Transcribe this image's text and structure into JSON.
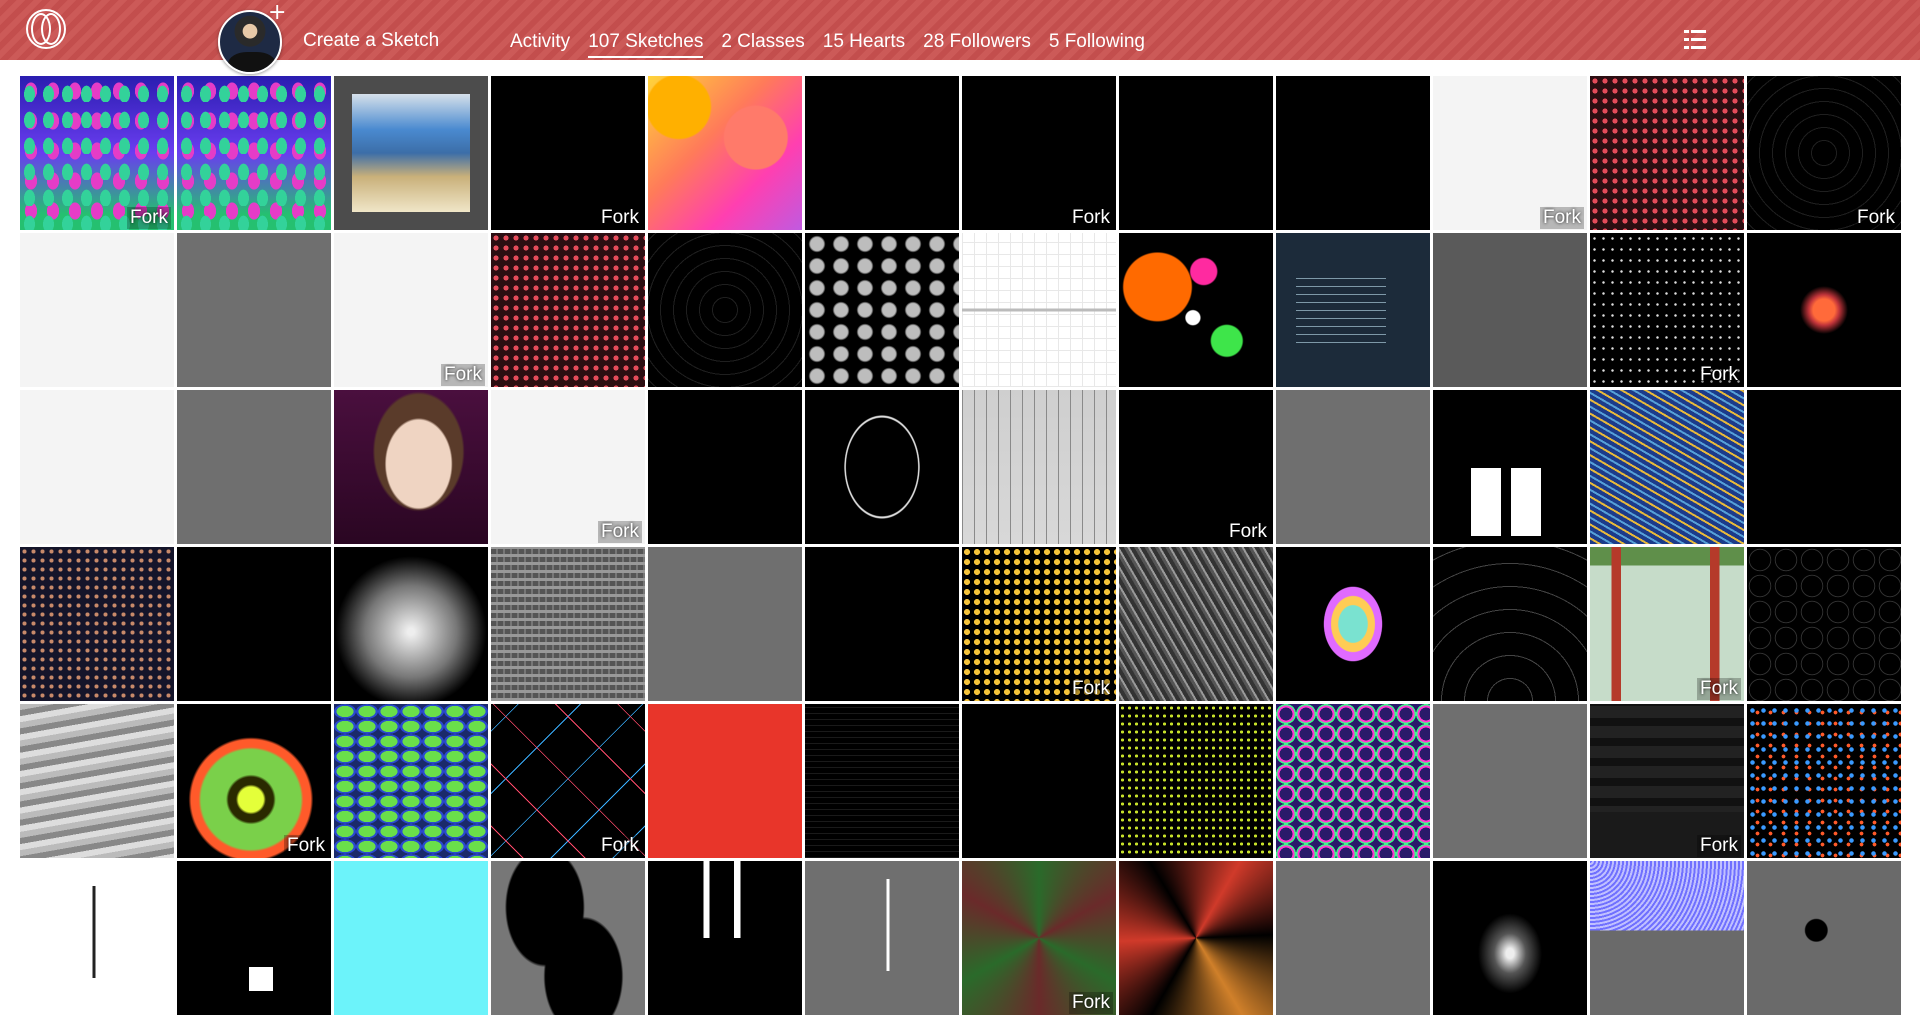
{
  "header": {
    "create_sketch": "Create a Sketch",
    "avatar_plus": "+",
    "nav": [
      {
        "label": "Activity",
        "active": false
      },
      {
        "label": "107 Sketches",
        "active": true
      },
      {
        "label": "2 Classes",
        "active": false
      },
      {
        "label": "15 Hearts",
        "active": false
      },
      {
        "label": "28 Followers",
        "active": false
      },
      {
        "label": "5 Following",
        "active": false
      }
    ],
    "bar_color": "#c9514f"
  },
  "fork_label": "Fork",
  "sketches": [
    {
      "icon": "ovals-pattern",
      "fork": true
    },
    {
      "icon": "ovals-pattern",
      "fork": false
    },
    {
      "icon": "painting",
      "fork": false
    },
    {
      "icon": "dark-dots",
      "fork": true
    },
    {
      "icon": "pastel-cells",
      "fork": false
    },
    {
      "icon": "black-canvas",
      "fork": false
    },
    {
      "icon": "black-canvas",
      "fork": true
    },
    {
      "icon": "dark-dots",
      "fork": false
    },
    {
      "icon": "black-canvas",
      "fork": false
    },
    {
      "icon": "white-canvas",
      "fork": true
    },
    {
      "icon": "flower-circles",
      "fork": false
    },
    {
      "icon": "radar-rings",
      "fork": true
    },
    {
      "icon": "white-canvas",
      "fork": false
    },
    {
      "icon": "gray-canvas",
      "fork": false
    },
    {
      "icon": "white-canvas",
      "fork": true
    },
    {
      "icon": "red-circles",
      "fork": false
    },
    {
      "icon": "radar-rings",
      "fork": false
    },
    {
      "icon": "gray-blobs",
      "fork": false
    },
    {
      "icon": "graph-plot",
      "fork": false
    },
    {
      "icon": "color-bubbles",
      "fork": false
    },
    {
      "icon": "essay-page",
      "fork": false
    },
    {
      "icon": "dark-gray-canvas",
      "fork": false
    },
    {
      "icon": "starfield",
      "fork": true
    },
    {
      "icon": "glow-orb",
      "fork": false
    },
    {
      "icon": "white-canvas",
      "fork": false
    },
    {
      "icon": "gray-canvas",
      "fork": false
    },
    {
      "icon": "portrait",
      "fork": false
    },
    {
      "icon": "white-canvas",
      "fork": true
    },
    {
      "icon": "black-canvas",
      "fork": false
    },
    {
      "icon": "wire-sphere",
      "fork": false
    },
    {
      "icon": "timeline-bars",
      "fork": false
    },
    {
      "icon": "black-canvas",
      "fork": true
    },
    {
      "icon": "gray-canvas",
      "fork": false
    },
    {
      "icon": "kittens",
      "fork": false
    },
    {
      "icon": "swirl-painting",
      "fork": false
    },
    {
      "icon": "black-canvas",
      "fork": false
    },
    {
      "icon": "halftone",
      "fork": false
    },
    {
      "icon": "black-canvas",
      "fork": false
    },
    {
      "icon": "line-burst",
      "fork": false
    },
    {
      "icon": "gray-text",
      "fork": false
    },
    {
      "icon": "gray-canvas",
      "fork": false
    },
    {
      "icon": "black-canvas",
      "fork": false
    },
    {
      "icon": "particles",
      "fork": true
    },
    {
      "icon": "noise-waves",
      "fork": false
    },
    {
      "icon": "color-blob",
      "fork": false
    },
    {
      "icon": "line-arcs",
      "fork": false
    },
    {
      "icon": "golden-gate",
      "fork": true
    },
    {
      "icon": "ring-grid",
      "fork": false
    },
    {
      "icon": "gray-terrain",
      "fork": false
    },
    {
      "icon": "green-spiral",
      "fork": true
    },
    {
      "icon": "stacked-discs",
      "fork": false
    },
    {
      "icon": "crosses",
      "fork": true
    },
    {
      "icon": "red-canvas",
      "fork": false
    },
    {
      "icon": "dim-lines",
      "fork": false
    },
    {
      "icon": "black-canvas",
      "fork": false
    },
    {
      "icon": "map-dots",
      "fork": false
    },
    {
      "icon": "color-chains",
      "fork": false
    },
    {
      "icon": "gray-canvas",
      "fork": false
    },
    {
      "icon": "color-names",
      "fork": true
    },
    {
      "icon": "confetti",
      "fork": false
    },
    {
      "icon": "tree",
      "fork": false
    },
    {
      "icon": "white-square",
      "fork": false
    },
    {
      "icon": "cyan-canvas",
      "fork": false
    },
    {
      "icon": "black-ellipses",
      "fork": false
    },
    {
      "icon": "white-stripes",
      "fork": false
    },
    {
      "icon": "falling-dots",
      "fork": false
    },
    {
      "icon": "green-star",
      "fork": true
    },
    {
      "icon": "red-star",
      "fork": false
    },
    {
      "icon": "gray-canvas",
      "fork": false
    },
    {
      "icon": "light-flare",
      "fork": false
    },
    {
      "icon": "moire",
      "fork": false
    },
    {
      "icon": "tiny-blob",
      "fork": false
    }
  ]
}
